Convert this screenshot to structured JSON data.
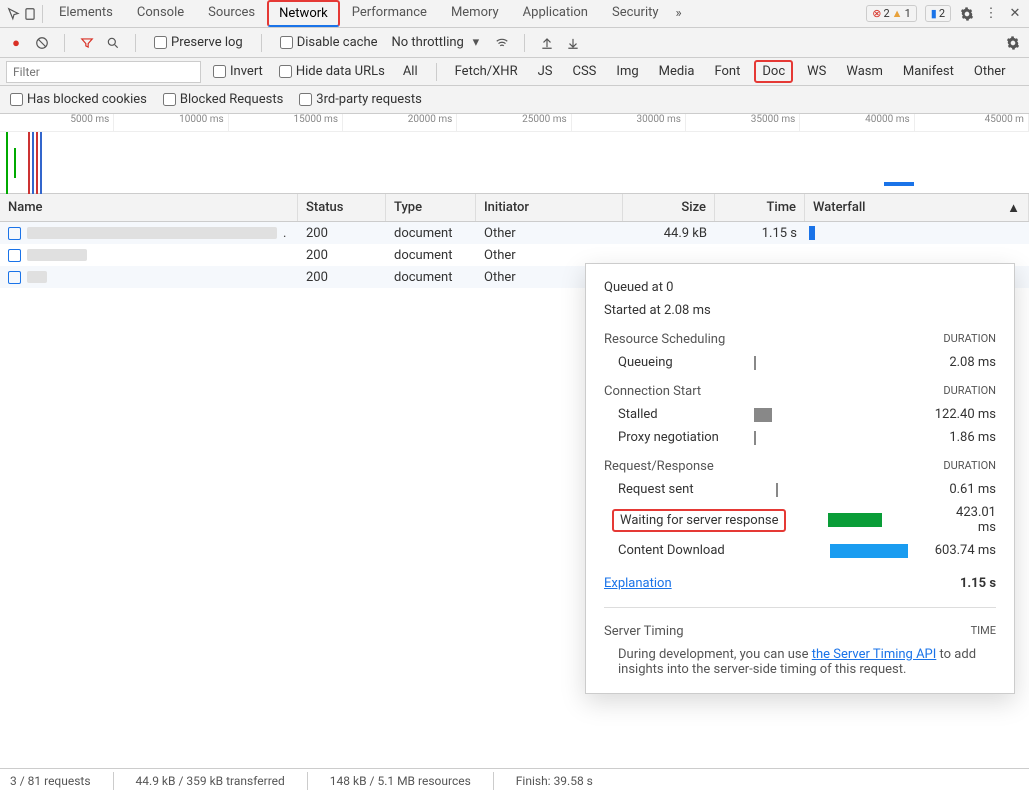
{
  "tabs": [
    "Elements",
    "Console",
    "Sources",
    "Network",
    "Performance",
    "Memory",
    "Application",
    "Security"
  ],
  "active_tab": "Network",
  "top_badges": {
    "error_count": "2",
    "warn_count": "1",
    "msg_count": "2"
  },
  "toolbar2": {
    "preserve_log": "Preserve log",
    "disable_cache": "Disable cache",
    "throttling": "No throttling"
  },
  "filter_row": {
    "placeholder": "Filter",
    "invert": "Invert",
    "hide_data": "Hide data URLs",
    "chips": [
      "All",
      "Fetch/XHR",
      "JS",
      "CSS",
      "Img",
      "Media",
      "Font",
      "Doc",
      "WS",
      "Wasm",
      "Manifest",
      "Other"
    ],
    "selected_chip": "Doc"
  },
  "filter_row2": {
    "blocked_cookies": "Has blocked cookies",
    "blocked_requests": "Blocked Requests",
    "third_party": "3rd-party requests"
  },
  "timeline_ticks": [
    "5000 ms",
    "10000 ms",
    "15000 ms",
    "20000 ms",
    "25000 ms",
    "30000 ms",
    "35000 ms",
    "40000 ms",
    "45000 m"
  ],
  "columns": {
    "name": "Name",
    "status": "Status",
    "type": "Type",
    "initiator": "Initiator",
    "size": "Size",
    "time": "Time",
    "waterfall": "Waterfall"
  },
  "rows": [
    {
      "status": "200",
      "type": "document",
      "initiator": "Other",
      "size": "44.9 kB",
      "time": "1.15 s"
    },
    {
      "status": "200",
      "type": "document",
      "initiator": "Other",
      "size": "",
      "time": ""
    },
    {
      "status": "200",
      "type": "document",
      "initiator": "Other",
      "size": "",
      "time": ""
    }
  ],
  "popover": {
    "queued": "Queued at 0",
    "started": "Started at 2.08 ms",
    "sections": {
      "resource_scheduling": "Resource Scheduling",
      "connection_start": "Connection Start",
      "request_response": "Request/Response"
    },
    "duration_label": "DURATION",
    "queueing": {
      "label": "Queueing",
      "value": "2.08 ms"
    },
    "stalled": {
      "label": "Stalled",
      "value": "122.40 ms"
    },
    "proxy": {
      "label": "Proxy negotiation",
      "value": "1.86 ms"
    },
    "sent": {
      "label": "Request sent",
      "value": "0.61 ms"
    },
    "waiting": {
      "label": "Waiting for server response",
      "value": "423.01 ms"
    },
    "download": {
      "label": "Content Download",
      "value": "603.74 ms"
    },
    "explanation": "Explanation",
    "total": "1.15 s",
    "server_timing": "Server Timing",
    "time_label": "TIME",
    "server_timing_text_pre": "During development, you can use ",
    "server_timing_link": "the Server Timing API",
    "server_timing_text_post": " to add insights into the server-side timing of this request."
  },
  "status_bar": {
    "requests": "3 / 81 requests",
    "transferred": "44.9 kB / 359 kB transferred",
    "resources": "148 kB / 5.1 MB resources",
    "finish": "Finish: 39.58 s"
  },
  "chart_data": {
    "type": "table",
    "title": "Request timing breakdown",
    "series": [
      {
        "name": "Queueing",
        "values": [
          2.08
        ]
      },
      {
        "name": "Stalled",
        "values": [
          122.4
        ]
      },
      {
        "name": "Proxy negotiation",
        "values": [
          1.86
        ]
      },
      {
        "name": "Request sent",
        "values": [
          0.61
        ]
      },
      {
        "name": "Waiting for server response",
        "values": [
          423.01
        ]
      },
      {
        "name": "Content Download",
        "values": [
          603.74
        ]
      }
    ],
    "total_ms": 1150
  }
}
